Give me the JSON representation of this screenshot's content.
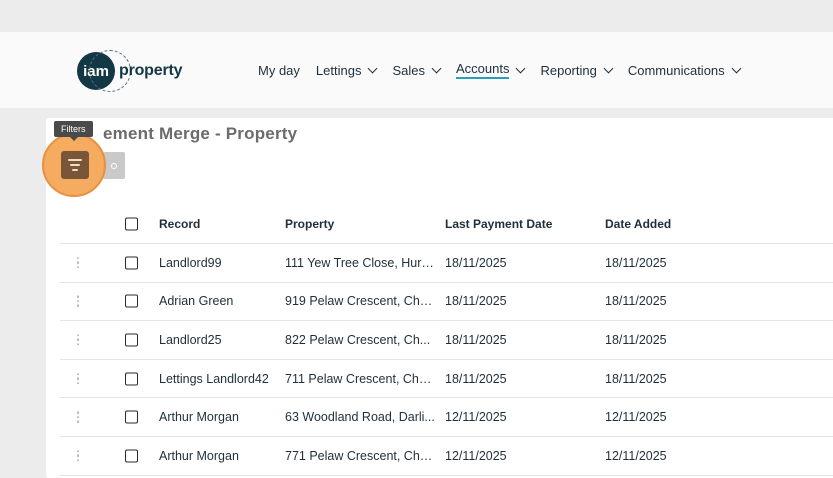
{
  "brand": {
    "logo_mark": "iam",
    "logo_word": "property"
  },
  "nav": [
    {
      "label": "My day",
      "has_menu": false,
      "active": false
    },
    {
      "label": "Lettings",
      "has_menu": true,
      "active": false
    },
    {
      "label": "Sales",
      "has_menu": true,
      "active": false
    },
    {
      "label": "Accounts",
      "has_menu": true,
      "active": true
    },
    {
      "label": "Reporting",
      "has_menu": true,
      "active": false
    },
    {
      "label": "Communications",
      "has_menu": true,
      "active": false
    }
  ],
  "page": {
    "title": "ement Merge - Property"
  },
  "tooltip": {
    "text": "Filters"
  },
  "toolbar": {
    "filter_icon": "filter-icon",
    "merge_icon": "merge-icon"
  },
  "table": {
    "columns": [
      "Record",
      "Property",
      "Last Payment Date",
      "Date Added"
    ],
    "rows": [
      {
        "record": "Landlord99",
        "property": "111 Yew Tree Close, Hurw...",
        "last_payment": "18/11/2025",
        "date_added": "18/11/2025"
      },
      {
        "record": "Adrian Green",
        "property": "919 Pelaw Crescent, Che...",
        "last_payment": "18/11/2025",
        "date_added": "18/11/2025"
      },
      {
        "record": "Landlord25",
        "property": "822 Pelaw Crescent, Ch...",
        "last_payment": "18/11/2025",
        "date_added": "18/11/2025"
      },
      {
        "record": "Lettings Landlord42",
        "property": "711 Pelaw Crescent, Che...",
        "last_payment": "18/11/2025",
        "date_added": "18/11/2025"
      },
      {
        "record": "Arthur Morgan",
        "property": "63 Woodland Road, Darli...",
        "last_payment": "12/11/2025",
        "date_added": "12/11/2025"
      },
      {
        "record": "Arthur Morgan",
        "property": "771 Pelaw Crescent, Che...",
        "last_payment": "12/11/2025",
        "date_added": "12/11/2025"
      }
    ]
  },
  "colors": {
    "brand": "#133845",
    "accent": "#2a9fb5",
    "highlight": "#f4a350",
    "filter_button": "#7a5638"
  }
}
